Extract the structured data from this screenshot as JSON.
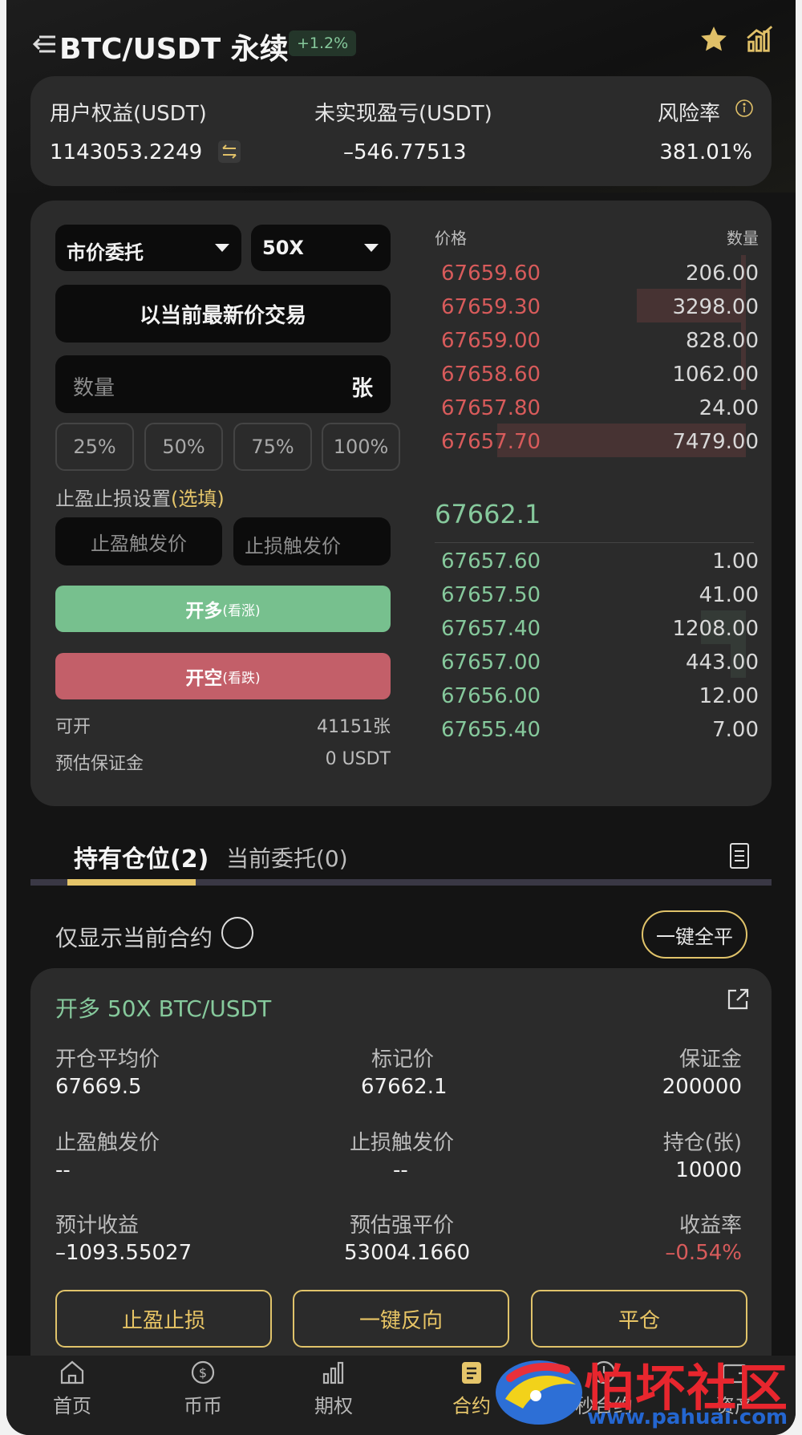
{
  "header": {
    "title": "BTC/USDT 永续",
    "change_badge": "+1.2%"
  },
  "account": {
    "equity_label": "用户权益(USDT)",
    "equity_value": "1143053.2249",
    "pnl_label": "未实现盈亏(USDT)",
    "pnl_value": "–546.77513",
    "risk_label": "风险率",
    "risk_value": "381.01%"
  },
  "order_form": {
    "order_type": "市价委托",
    "leverage": "50X",
    "price_mode": "以当前最新价交易",
    "quantity_placeholder": "数量",
    "quantity_unit": "张",
    "percent_options": [
      "25%",
      "50%",
      "75%",
      "100%"
    ],
    "tpsl_label": "止盈止损设置",
    "tpsl_optional": "(选填)",
    "tp_placeholder": "止盈触发价",
    "sl_placeholder": "止损触发价",
    "long_button": "开多",
    "long_hint": "(看涨)",
    "short_button": "开空",
    "short_hint": "(看跌)",
    "available_label": "可开",
    "available_value": "41151张",
    "margin_label": "预估保证金",
    "margin_value": "0 USDT"
  },
  "orderbook": {
    "price_header": "价格",
    "qty_header": "数量",
    "asks": [
      {
        "price": "67659.60",
        "qty": "206.00",
        "depth": 0.02
      },
      {
        "price": "67659.30",
        "qty": "3298.00",
        "depth": 0.44
      },
      {
        "price": "67659.00",
        "qty": "828.00",
        "depth": 0.02
      },
      {
        "price": "67658.60",
        "qty": "1062.00",
        "depth": 0.02
      },
      {
        "price": "67657.80",
        "qty": "24.00",
        "depth": 0.0
      },
      {
        "price": "67657.70",
        "qty": "7479.00",
        "depth": 1.0
      }
    ],
    "last_price": "67662.1",
    "bids": [
      {
        "price": "67657.60",
        "qty": "1.00",
        "depth": 0.0
      },
      {
        "price": "67657.50",
        "qty": "41.00",
        "depth": 0.0
      },
      {
        "price": "67657.40",
        "qty": "1208.00",
        "depth": 0.18
      },
      {
        "price": "67657.00",
        "qty": "443.00",
        "depth": 0.06
      },
      {
        "price": "67656.00",
        "qty": "12.00",
        "depth": 0.0
      },
      {
        "price": "67655.40",
        "qty": "7.00",
        "depth": 0.0
      }
    ]
  },
  "tabs": {
    "positions": "持有仓位(2)",
    "orders": "当前委托(0)"
  },
  "filter": {
    "label": "仅显示当前合约",
    "close_all": "一键全平"
  },
  "position": {
    "title": "开多 50X BTC/USDT",
    "avg_price_label": "开仓平均价",
    "avg_price": "67669.5",
    "mark_price_label": "标记价",
    "mark_price": "67662.1",
    "margin_label": "保证金",
    "margin": "200000",
    "tp_label": "止盈触发价",
    "tp_value": "--",
    "sl_label": "止损触发价",
    "sl_value": "--",
    "size_label": "持仓(张)",
    "size": "10000",
    "est_pnl_label": "预计收益",
    "est_pnl": "–1093.55027",
    "liq_label": "预估强平价",
    "liq_price": "53004.1660",
    "roe_label": "收益率",
    "roe": "–0.54%",
    "btn_tpsl": "止盈止损",
    "btn_reverse": "一键反向",
    "btn_close": "平仓"
  },
  "bottom_nav": [
    {
      "label": "首页",
      "icon": "home-icon"
    },
    {
      "label": "币币",
      "icon": "coin-icon"
    },
    {
      "label": "期权",
      "icon": "bar-chart-icon"
    },
    {
      "label": "合约",
      "icon": "contract-icon"
    },
    {
      "label": "秒合约",
      "icon": "clock-icon"
    },
    {
      "label": "资产",
      "icon": "wallet-icon"
    }
  ],
  "watermark": {
    "text": "怕坏社区",
    "url": "www.pahuai.com"
  },
  "colors": {
    "up": "#86c99c",
    "down": "#d85b5b",
    "accent": "#e5c56a",
    "long_button": "#77c08e",
    "short_button": "#c35f69"
  }
}
